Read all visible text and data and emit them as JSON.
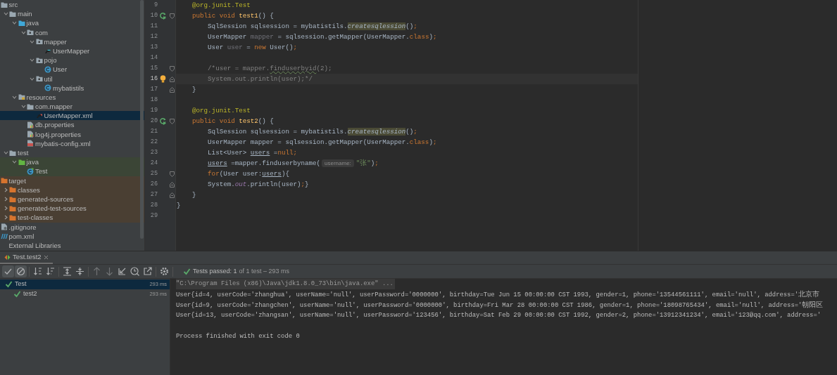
{
  "project_tree": {
    "items": [
      {
        "label": "src",
        "kind": "folder",
        "selected": false,
        "children": [
          {
            "label": "main",
            "kind": "folder",
            "expanded": true,
            "selected": false,
            "children": [
              {
                "label": "java",
                "kind": "source-root",
                "expanded": true,
                "selected": false,
                "children": [
                  {
                    "label": "com",
                    "kind": "package",
                    "expanded": true,
                    "selected": false,
                    "children": [
                      {
                        "label": "mapper",
                        "kind": "package",
                        "expanded": true,
                        "selected": false,
                        "children": [
                          {
                            "label": "UserMapper",
                            "kind": "interface",
                            "selected": false
                          }
                        ]
                      },
                      {
                        "label": "pojo",
                        "kind": "package",
                        "expanded": true,
                        "selected": false,
                        "children": [
                          {
                            "label": "User",
                            "kind": "class",
                            "selected": false
                          }
                        ]
                      },
                      {
                        "label": "util",
                        "kind": "package",
                        "expanded": true,
                        "selected": false,
                        "children": [
                          {
                            "label": "mybatistils",
                            "kind": "class",
                            "selected": false
                          }
                        ]
                      }
                    ]
                  }
                ]
              },
              {
                "label": "resources",
                "kind": "resources-root",
                "expanded": true,
                "selected": false,
                "children": [
                  {
                    "label": "com.mapper",
                    "kind": "folder",
                    "expanded": true,
                    "selected": false,
                    "children": [
                      {
                        "label": "UserMapper.xml",
                        "kind": "mapper-xml",
                        "selected": true
                      }
                    ]
                  },
                  {
                    "label": "db.properties",
                    "kind": "properties",
                    "selected": false
                  },
                  {
                    "label": "log4j.properties",
                    "kind": "properties",
                    "selected": false
                  },
                  {
                    "label": "mybatis-config.xml",
                    "kind": "config-xml",
                    "selected": false
                  }
                ]
              }
            ]
          },
          {
            "label": "test",
            "kind": "folder",
            "expanded": true,
            "selected": false,
            "children": [
              {
                "label": "java",
                "kind": "test-root",
                "expanded": true,
                "selected": false,
                "children": [
                  {
                    "label": "Test",
                    "kind": "test-class",
                    "selected": false
                  }
                ]
              }
            ]
          }
        ]
      },
      {
        "label": "target",
        "kind": "excluded-folder",
        "selected": false,
        "children": [
          {
            "label": "classes",
            "kind": "excluded-folder",
            "expanded": false,
            "selected": false
          },
          {
            "label": "generated-sources",
            "kind": "excluded-folder",
            "expanded": false,
            "selected": false
          },
          {
            "label": "generated-test-sources",
            "kind": "excluded-folder",
            "expanded": false,
            "selected": false
          },
          {
            "label": "test-classes",
            "kind": "excluded-folder",
            "expanded": false,
            "selected": false
          }
        ]
      },
      {
        "label": ".gitignore",
        "kind": "gitignore",
        "selected": false
      },
      {
        "label": "pom.xml",
        "kind": "maven",
        "selected": false
      },
      {
        "label": "External Libraries",
        "selected": false
      }
    ]
  },
  "editor": {
    "lines": [
      {
        "number": "9",
        "tokens": [
          {
            "text": "    @org.junit.Test",
            "kind": "annotation"
          }
        ]
      },
      {
        "number": "10",
        "run_marker": true,
        "fold_start": true,
        "tokens": [
          {
            "text": "    public void ",
            "kind": "keyword"
          },
          {
            "text": "test1",
            "kind": "method"
          },
          {
            "text": "() {",
            "kind": "plain"
          }
        ]
      },
      {
        "number": "11",
        "tokens": [
          {
            "text": "        SqlSession sqlsession = mybatistils.",
            "kind": "plain"
          },
          {
            "text": "createsqlession",
            "kind": "highlight-call"
          },
          {
            "text": "()",
            "kind": "plain"
          },
          {
            "text": ";",
            "kind": "keyword"
          }
        ]
      },
      {
        "number": "12",
        "tokens": [
          {
            "text": "        UserMapper ",
            "kind": "plain"
          },
          {
            "text": "mapper",
            "kind": "unused"
          },
          {
            "text": " = sqlsession.getMapper(UserMapper.",
            "kind": "plain"
          },
          {
            "text": "class",
            "kind": "keyword"
          },
          {
            "text": ")",
            "kind": "plain"
          },
          {
            "text": ";",
            "kind": "keyword"
          }
        ]
      },
      {
        "number": "13",
        "tokens": [
          {
            "text": "        User ",
            "kind": "plain"
          },
          {
            "text": "user",
            "kind": "unused"
          },
          {
            "text": " = ",
            "kind": "plain"
          },
          {
            "text": "new ",
            "kind": "keyword"
          },
          {
            "text": "User()",
            "kind": "plain"
          },
          {
            "text": ";",
            "kind": "keyword"
          }
        ]
      },
      {
        "number": "14"
      },
      {
        "number": "15",
        "fold_start": true,
        "tokens": [
          {
            "text": "        /*user = mapper.",
            "kind": "comment"
          },
          {
            "text": "finduserbyid",
            "kind": "squiggle"
          },
          {
            "text": "(2);",
            "kind": "comment"
          }
        ]
      },
      {
        "number": "16",
        "intention_bulb": true,
        "fold_end": true,
        "current": true,
        "tokens": [
          {
            "text": "        System.out.println(user);*/",
            "kind": "comment"
          }
        ]
      },
      {
        "number": "17",
        "fold_end": true,
        "tokens": [
          {
            "text": "    }",
            "kind": "plain"
          }
        ]
      },
      {
        "number": "18"
      },
      {
        "number": "19",
        "tokens": [
          {
            "text": "    @org.junit.Test",
            "kind": "annotation"
          }
        ]
      },
      {
        "number": "20",
        "run_marker": true,
        "fold_start": true,
        "tokens": [
          {
            "text": "    public void ",
            "kind": "keyword"
          },
          {
            "text": "test2",
            "kind": "method"
          },
          {
            "text": "() {",
            "kind": "plain"
          }
        ]
      },
      {
        "number": "21",
        "tokens": [
          {
            "text": "        SqlSession sqlsession = mybatistils.",
            "kind": "plain"
          },
          {
            "text": "createsqlession",
            "kind": "highlight-call"
          },
          {
            "text": "()",
            "kind": "plain"
          },
          {
            "text": ";",
            "kind": "keyword"
          }
        ]
      },
      {
        "number": "22",
        "tokens": [
          {
            "text": "        UserMapper mapper = sqlsession.getMapper(UserMapper.",
            "kind": "plain"
          },
          {
            "text": "class",
            "kind": "keyword"
          },
          {
            "text": ")",
            "kind": "plain"
          },
          {
            "text": ";",
            "kind": "keyword"
          }
        ]
      },
      {
        "number": "23",
        "tokens": [
          {
            "text": "        List<User> ",
            "kind": "plain"
          },
          {
            "text": "users",
            "kind": "reassigned"
          },
          {
            "text": " =",
            "kind": "plain"
          },
          {
            "text": "null",
            "kind": "keyword"
          },
          {
            "text": ";",
            "kind": "keyword"
          }
        ]
      },
      {
        "number": "24",
        "tokens": [
          {
            "text": "        users",
            "kind": "reassigned"
          },
          {
            "text": " =mapper.finduserbyname(",
            "kind": "plain"
          },
          {
            "text": "username:",
            "kind": "hint"
          },
          {
            "text": "\"张\"",
            "kind": "string"
          },
          {
            "text": ")",
            "kind": "plain"
          },
          {
            "text": ";",
            "kind": "keyword"
          }
        ]
      },
      {
        "number": "25",
        "fold_start": true,
        "tokens": [
          {
            "text": "        for",
            "kind": "keyword"
          },
          {
            "text": "(User user:",
            "kind": "plain"
          },
          {
            "text": "users",
            "kind": "reassigned"
          },
          {
            "text": "){",
            "kind": "plain"
          }
        ]
      },
      {
        "number": "26",
        "fold_end": true,
        "tokens": [
          {
            "text": "        System.",
            "kind": "plain"
          },
          {
            "text": "out",
            "kind": "field"
          },
          {
            "text": ".println(user)",
            "kind": "plain"
          },
          {
            "text": ";",
            "kind": "keyword"
          },
          {
            "text": "}",
            "kind": "plain"
          }
        ]
      },
      {
        "number": "27",
        "fold_end": true,
        "tokens": [
          {
            "text": "    }",
            "kind": "plain"
          }
        ]
      },
      {
        "number": "28",
        "tokens": [
          {
            "text": "}",
            "kind": "plain"
          }
        ]
      },
      {
        "number": "29"
      }
    ]
  },
  "run_panel": {
    "tab": {
      "label": "Test.test2",
      "selected": true
    },
    "toolbar": [
      [
        {
          "kind": "check",
          "on": true,
          "disabled": false
        },
        {
          "kind": "ignored",
          "on": true,
          "disabled": false
        }
      ],
      [
        {
          "kind": "sort-alpha",
          "on": false,
          "disabled": false
        },
        {
          "kind": "sort-duration",
          "on": false,
          "disabled": false
        }
      ],
      [
        {
          "kind": "expand-all",
          "disabled": false
        },
        {
          "kind": "collapse-all",
          "disabled": false
        }
      ],
      [
        {
          "kind": "up",
          "disabled": true
        },
        {
          "kind": "down",
          "disabled": true
        },
        {
          "kind": "import",
          "disabled": false
        },
        {
          "kind": "history",
          "disabled": false
        },
        {
          "kind": "export",
          "disabled": false
        }
      ],
      [
        {
          "kind": "settings",
          "disabled": false
        }
      ]
    ],
    "status": {
      "summary": "Tests passed: 1",
      "detail": "of 1 test – 293 ms"
    },
    "tests": [
      {
        "label": "Test",
        "duration": "293 ms",
        "passed": true,
        "selected": true,
        "children": [
          {
            "label": "test2",
            "duration": "293 ms",
            "passed": true,
            "selected": false
          }
        ]
      }
    ],
    "console": [
      {
        "kind": "command",
        "text": "\"C:\\Program Files (x86)\\Java\\jdk1.8.0_73\\bin\\java.exe\" ..."
      },
      {
        "kind": "output",
        "text": "User{id=4, userCode='zhanghua', userName='null', userPassword='0000000', birthday=Tue Jun 15 00:00:00 CST 1993, gender=1, phone='13544561111', email='null', address='北京市"
      },
      {
        "kind": "output",
        "text": "User{id=9, userCode='zhangchen', userName='null', userPassword='0000000', birthday=Fri Mar 28 00:00:00 CST 1986, gender=1, phone='18098765434', email='null', address='朝阳区"
      },
      {
        "kind": "output",
        "text": "User{id=13, userCode='zhangsan', userName='null', userPassword='123456', birthday=Sat Feb 29 00:00:00 CST 1992, gender=2, phone='13912341234', email='123@qq.com', address='"
      },
      {
        "kind": "exit",
        "text": "Process finished with exit code 0"
      }
    ]
  }
}
